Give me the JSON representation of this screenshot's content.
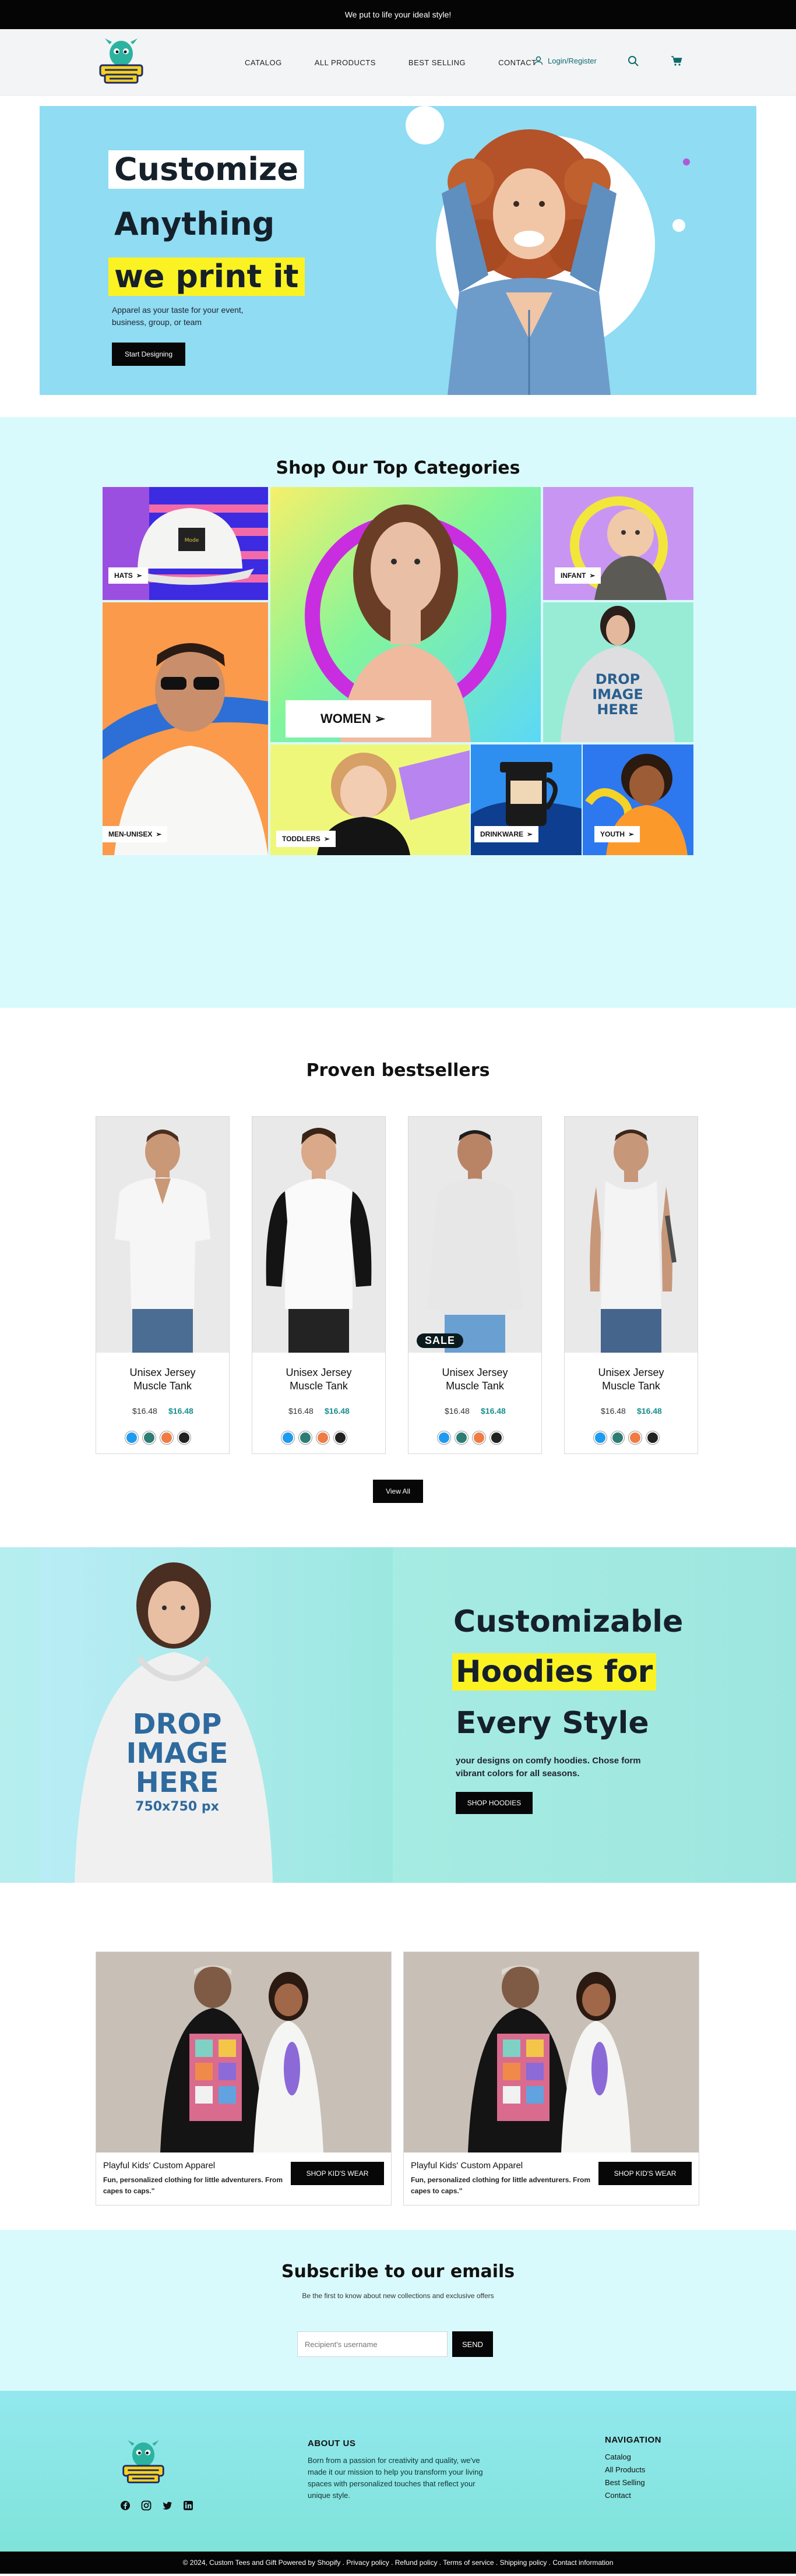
{
  "announcement": {
    "text": "We put to life your ideal style!"
  },
  "header": {
    "nav": [
      "CATALOG",
      "ALL PRODUCTS",
      "BEST SELLING",
      "CONTACT"
    ],
    "login_label": "Login/Register",
    "icons": [
      "user-icon",
      "search-icon",
      "cart-icon"
    ],
    "logo_text": "CUSTOM TEES & GIFTS"
  },
  "hero": {
    "line1": "Customize",
    "line2": "Anything",
    "line3": "we print it",
    "subtitle": "Apparel as your taste for your event, business, group, or team",
    "button": "Start Designing"
  },
  "categories": {
    "title": "Shop Our Top Categories",
    "tiles": [
      "HATS",
      "WOMEN",
      "INFANT",
      "MEN-UNISEX",
      "TODDLERS",
      "DRINKWARE",
      "YOUTH"
    ],
    "hoodie_print": [
      "DROP",
      "IMAGE",
      "HERE"
    ]
  },
  "bestsellers": {
    "title": "Proven bestsellers",
    "products": [
      {
        "name": "Unisex Jersey Muscle Tank",
        "old_price": "$16.48",
        "new_price": "$16.48",
        "sale": ""
      },
      {
        "name": "Unisex Jersey Muscle Tank",
        "old_price": "$16.48",
        "new_price": "$16.48",
        "sale": ""
      },
      {
        "name": "Unisex Jersey Muscle Tank",
        "old_price": "$16.48",
        "new_price": "$16.48",
        "sale": "SALE"
      },
      {
        "name": "Unisex Jersey Muscle Tank",
        "old_price": "$16.48",
        "new_price": "$16.48",
        "sale": ""
      }
    ],
    "swatch_colors": [
      "#1e9bf0",
      "#2e7d74",
      "#f07c44",
      "#222222"
    ],
    "view_all": "View All"
  },
  "promo": {
    "line1": "Customizable",
    "line2": "Hoodies for",
    "line3": "Every Style",
    "subtitle": "your designs on comfy hoodies. Chose form vibrant colors for all seasons.",
    "button": "SHOP HOODIES",
    "hoodie_print": [
      "DROP",
      "IMAGE",
      "HERE",
      "750x750 px"
    ]
  },
  "kids": [
    {
      "title": "Playful Kids' Custom Apparel",
      "desc": "Fun, personalized clothing for little adventurers. From capes to caps.\"",
      "button": "SHOP KID'S WEAR"
    },
    {
      "title": "Playful Kids' Custom Apparel",
      "desc": "Fun, personalized clothing for little adventurers. From capes to caps.\"",
      "button": "SHOP KID'S WEAR"
    }
  ],
  "subscribe": {
    "title": "Subscribe to our emails",
    "note": "Be the first to know about new collections and exclusive offers",
    "placeholder": "Recipient's username",
    "button": "SEND"
  },
  "footer": {
    "about_title": "ABOUT US",
    "about_text": "Born from a passion for creativity and quality, we've made it our mission to help you transform your living spaces with personalized touches that reflect your unique style.",
    "nav_title": "NAVIGATION",
    "nav_links": [
      "Catalog",
      "All Products",
      "Best Selling",
      "Contact"
    ],
    "socials": [
      "facebook-icon",
      "instagram-icon",
      "twitter-icon",
      "linkedin-icon"
    ],
    "copyright": "© 2024, Custom Tees and Gift Powered by Shopify . Privacy policy . Refund policy . Terms of service . Shipping policy . Contact information"
  }
}
